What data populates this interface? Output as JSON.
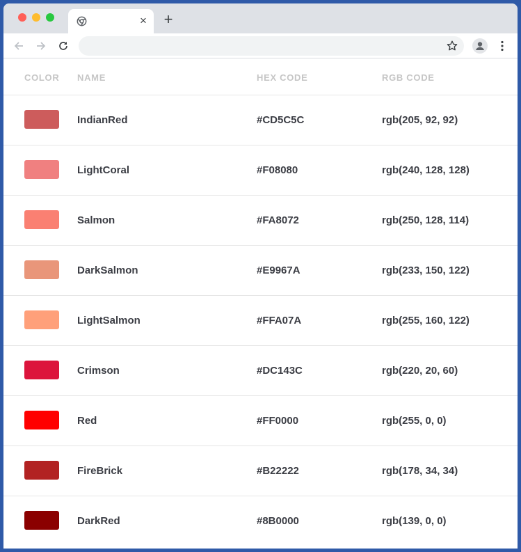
{
  "browser": {
    "tab_close_glyph": "×",
    "new_tab_glyph": "+",
    "icons": [
      "chrome-icon",
      "close-icon",
      "plus-icon",
      "back-arrow-icon",
      "forward-arrow-icon",
      "reload-icon",
      "star-icon",
      "profile-icon",
      "kebab-menu-icon"
    ]
  },
  "table": {
    "headers": {
      "color": "COLOR",
      "name": "NAME",
      "hex": "HEX CODE",
      "rgb": "RGB CODE"
    },
    "rows": [
      {
        "swatch": "#CD5C5C",
        "name": "IndianRed",
        "hex": "#CD5C5C",
        "rgb": "rgb(205, 92, 92)"
      },
      {
        "swatch": "#F08080",
        "name": "LightCoral",
        "hex": "#F08080",
        "rgb": "rgb(240, 128, 128)"
      },
      {
        "swatch": "#FA8072",
        "name": "Salmon",
        "hex": "#FA8072",
        "rgb": "rgb(250, 128, 114)"
      },
      {
        "swatch": "#E9967A",
        "name": "DarkSalmon",
        "hex": "#E9967A",
        "rgb": "rgb(233, 150, 122)"
      },
      {
        "swatch": "#FFA07A",
        "name": "LightSalmon",
        "hex": "#FFA07A",
        "rgb": "rgb(255, 160, 122)"
      },
      {
        "swatch": "#DC143C",
        "name": "Crimson",
        "hex": "#DC143C",
        "rgb": "rgb(220, 20, 60)"
      },
      {
        "swatch": "#FF0000",
        "name": "Red",
        "hex": "#FF0000",
        "rgb": "rgb(255, 0, 0)"
      },
      {
        "swatch": "#B22222",
        "name": "FireBrick",
        "hex": "#B22222",
        "rgb": "rgb(178, 34, 34)"
      },
      {
        "swatch": "#8B0000",
        "name": "DarkRed",
        "hex": "#8B0000",
        "rgb": "rgb(139, 0, 0)"
      }
    ]
  }
}
